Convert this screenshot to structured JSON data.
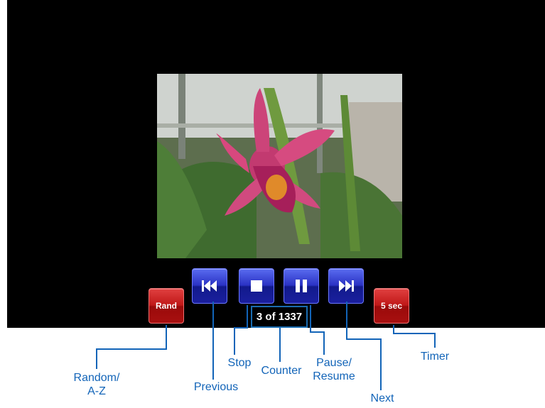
{
  "player": {
    "random_button_label": "Rand",
    "timer_button_label": "5 sec",
    "counter_text": "3 of 1337"
  },
  "callouts": {
    "random": "Random/\nA-Z",
    "previous": "Previous",
    "stop": "Stop",
    "counter": "Counter",
    "pause": "Pause/\nResume",
    "next": "Next",
    "timer": "Timer"
  },
  "colors": {
    "callout_line": "#1264b8",
    "blue_button": "#2a32c4",
    "red_button": "#c01818"
  },
  "icons": [
    "skip-previous-icon",
    "stop-icon",
    "pause-icon",
    "skip-next-icon"
  ]
}
